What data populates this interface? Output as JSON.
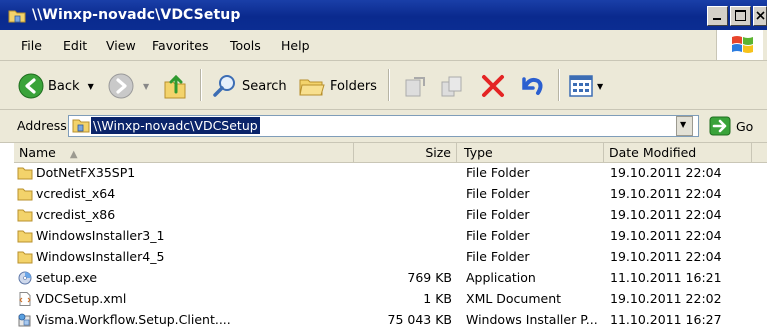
{
  "window": {
    "title": "\\\\Winxp-novadc\\VDCSetup"
  },
  "menu": [
    "File",
    "Edit",
    "View",
    "Favorites",
    "Tools",
    "Help"
  ],
  "toolbar": {
    "back_label": "Back",
    "search_label": "Search",
    "folders_label": "Folders"
  },
  "address": {
    "label": "Address",
    "value": "\\\\Winxp-novadc\\VDCSetup",
    "go_label": "Go"
  },
  "columns": {
    "name": "Name",
    "size": "Size",
    "type": "Type",
    "date": "Date Modified"
  },
  "files": [
    {
      "name": "DotNetFX35SP1",
      "size": "",
      "type": "File Folder",
      "date": "19.10.2011 22:04",
      "icon": "folder-icon"
    },
    {
      "name": "vcredist_x64",
      "size": "",
      "type": "File Folder",
      "date": "19.10.2011 22:04",
      "icon": "folder-icon"
    },
    {
      "name": "vcredist_x86",
      "size": "",
      "type": "File Folder",
      "date": "19.10.2011 22:04",
      "icon": "folder-icon"
    },
    {
      "name": "WindowsInstaller3_1",
      "size": "",
      "type": "File Folder",
      "date": "19.10.2011 22:04",
      "icon": "folder-icon"
    },
    {
      "name": "WindowsInstaller4_5",
      "size": "",
      "type": "File Folder",
      "date": "19.10.2011 22:04",
      "icon": "folder-icon"
    },
    {
      "name": "setup.exe",
      "size": "769 KB",
      "type": "Application",
      "date": "11.10.2011 16:21",
      "icon": "setup-exe-icon"
    },
    {
      "name": "VDCSetup.xml",
      "size": "1 KB",
      "type": "XML Document",
      "date": "19.10.2011 22:02",
      "icon": "xml-document-icon"
    },
    {
      "name": "Visma.Workflow.Setup.Client....",
      "size": "75 043 KB",
      "type": "Windows Installer P...",
      "date": "11.10.2011 16:27",
      "icon": "msi-package-icon"
    }
  ],
  "colors": {
    "title_bar": "#0a2a8e",
    "chrome": "#ece9d8",
    "selection": "#0a246a"
  }
}
